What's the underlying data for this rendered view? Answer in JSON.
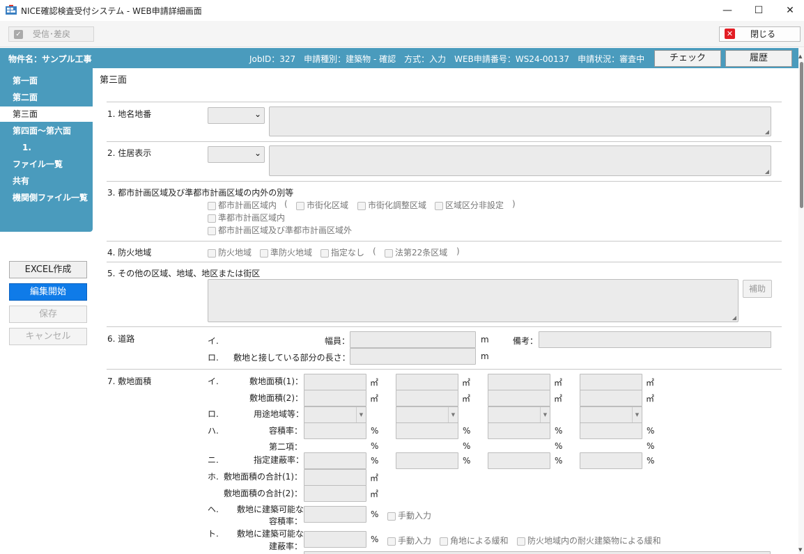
{
  "window": {
    "title": "NICE確認検査受付システム - WEB申請詳細画面",
    "minimize": "—",
    "maximize": "☐",
    "close": "✕"
  },
  "toolbar": {
    "receive_label": "受信･差戻",
    "close_label": "閉じる"
  },
  "header": {
    "property": "物件名：サンプル工事",
    "info": "JobID：327　申請種別：建築物 - 確認　方式：入力　WEB申請番号：WS24-00137　申請状況：審査中",
    "check_label": "チェック",
    "history_label": "履歴"
  },
  "sidenav": {
    "items": [
      "第一面",
      "第二面",
      "第三面",
      "第四面～第六面",
      "1.",
      "ファイル一覧",
      "共有",
      "機関側ファイル一覧"
    ],
    "active_index": 2
  },
  "sidebuttons": {
    "excel": "EXCEL作成",
    "edit": "編集開始",
    "save": "保存",
    "cancel": "キャンセル"
  },
  "page": {
    "heading": "第三面"
  },
  "s1": {
    "label": "1. 地名地番"
  },
  "s2": {
    "label": "2. 住居表示"
  },
  "s3": {
    "label": "3. 都市計画区域及び準都市計画区域の内外の別等",
    "cb1": "都市計画区域内",
    "paren_open": "(",
    "cb2": "市街化区域",
    "cb3": "市街化調整区域",
    "cb4": "区域区分非設定",
    "paren_close": ")",
    "cb5": "準都市計画区域内",
    "cb6": "都市計画区域及び準都市計画区域外"
  },
  "s4": {
    "label": "4. 防火地域",
    "cb1": "防火地域",
    "cb2": "準防火地域",
    "cb3": "指定なし",
    "paren_open": "(",
    "cb4": "法第22条区域",
    "paren_close": ")"
  },
  "s5": {
    "label": "5. その他の区域、地域、地区または街区",
    "assist": "補助"
  },
  "s6": {
    "label": "6. 道路",
    "i": "イ.",
    "width_label": "幅員：",
    "unit": "m",
    "note_label": "備考：",
    "ro": "ロ.",
    "contact_label": "敷地と接している部分の長さ："
  },
  "s7": {
    "label": "7. 敷地面積",
    "i": "イ.",
    "area1": "敷地面積(1)：",
    "area2": "敷地面積(2)：",
    "sqm": "㎡",
    "ro": "ロ.",
    "use_zone": "用途地域等：",
    "ha": "ハ.",
    "far": "容積率：",
    "second": "第二項：",
    "pct": "%",
    "ni": "ニ.",
    "bcr": "指定建蔽率：",
    "ho": "ホ.",
    "total1": "敷地面積の合計(1)：",
    "total2": "敷地面積の合計(2)：",
    "he": "ヘ.",
    "buildable_far_1": "敷地に建築可能な",
    "buildable_far_2": "容積率：",
    "manual": "手動入力",
    "to": "ト.",
    "buildable_bcr_1": "敷地に建築可能な",
    "buildable_bcr_2": "建蔽率：",
    "corner": "角地による緩和",
    "fireproof": "防火地域内の耐火建築物による緩和"
  }
}
